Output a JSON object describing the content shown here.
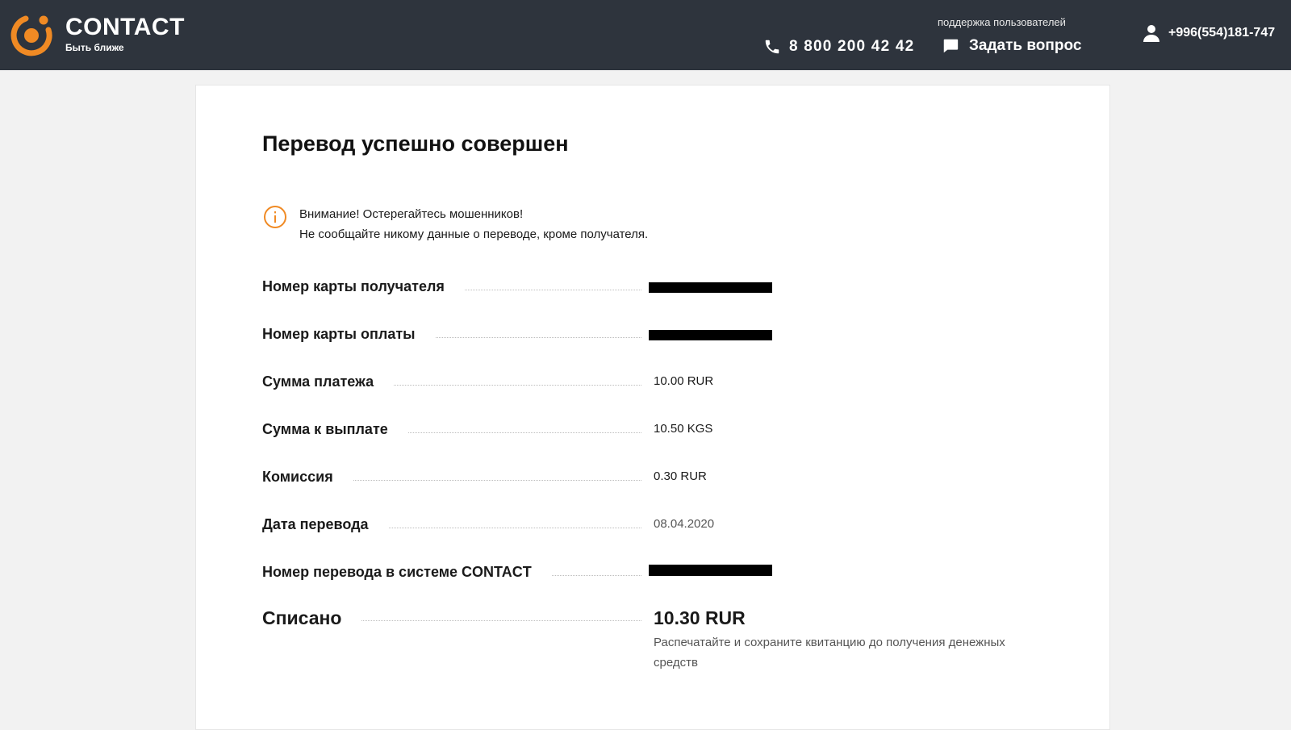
{
  "header": {
    "brand_name": "CONTACT",
    "brand_tagline": "Быть ближе",
    "phone": "8 800 200 42 42",
    "support_label": "поддержка пользователей",
    "ask_label": "Задать вопрос",
    "user_phone": "+996(554)181-747"
  },
  "colors": {
    "header_bg": "#2e343d",
    "accent": "#f08a24",
    "card_bg": "#ffffff",
    "page_bg": "#f2f2f2"
  },
  "icons": {
    "logo": "contact-logo",
    "phone": "phone-icon",
    "chat": "chat-icon",
    "user": "user-icon",
    "warning": "info-circle-icon"
  },
  "main": {
    "title": "Перевод успешно совершен",
    "warning_line1": "Внимание! Остерегайтесь мошенников!",
    "warning_line2": "Не сообщайте никому данные о переводе, кроме получателя.",
    "rows": [
      {
        "label": "Номер карты получателя",
        "value": "",
        "redacted": true
      },
      {
        "label": "Номер карты оплаты",
        "value": "",
        "redacted": true
      },
      {
        "label": "Сумма платежа",
        "value": "10.00 RUR"
      },
      {
        "label": "Сумма к выплате",
        "value": "10.50 KGS"
      },
      {
        "label": "Комиссия",
        "value": "0.30 RUR"
      },
      {
        "label": "Дата перевода",
        "value": "08.04.2020"
      },
      {
        "label": "Номер перевода в системе CONTACT",
        "value": "",
        "redacted": true
      }
    ],
    "total": {
      "label": "Списано",
      "value": "10.30 RUR",
      "note": "Распечатайте и сохраните квитанцию до получения денежных средств"
    }
  }
}
